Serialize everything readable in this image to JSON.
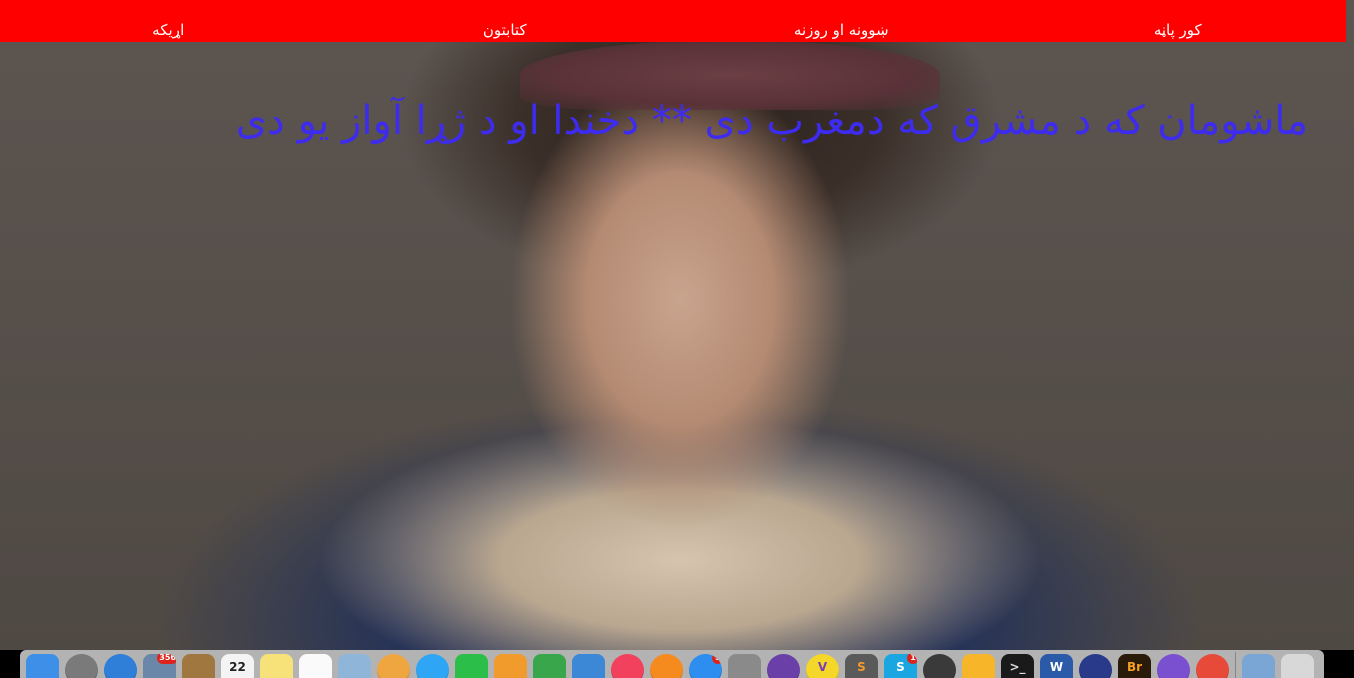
{
  "nav": {
    "items": [
      {
        "label": "کور پاڼه"
      },
      {
        "label": "ښوونه او روزنه"
      },
      {
        "label": "کتابتون"
      },
      {
        "label": "اړیکه"
      }
    ],
    "background_color": "#ff0000",
    "text_color": "#ffffff"
  },
  "headline": {
    "text": "ماشومان که د مشرق که دمغرب دی ** دخندا او د ژړا آواز یو دی",
    "color": "#3d2bf0"
  },
  "dock": {
    "icons": [
      {
        "name": "finder-icon",
        "color": "#3d8fe8"
      },
      {
        "name": "launchpad-icon",
        "color": "#7a7a7a",
        "round": true
      },
      {
        "name": "safari-icon",
        "color": "#2f7fd8",
        "round": true
      },
      {
        "name": "mail-stamp-icon",
        "color": "#6a86a8",
        "badge": "356"
      },
      {
        "name": "contacts-icon",
        "color": "#a0773f"
      },
      {
        "name": "calendar-icon",
        "color": "#f4f4f4",
        "text": "22",
        "text_color": "#222222"
      },
      {
        "name": "notes-icon",
        "color": "#f7e27a"
      },
      {
        "name": "reminders-icon",
        "color": "#fafafa"
      },
      {
        "name": "preview-icon",
        "color": "#8fb6d9"
      },
      {
        "name": "photos-icon",
        "color": "#f0a640",
        "round": true
      },
      {
        "name": "messages-icon",
        "color": "#2fa6f5",
        "round": true
      },
      {
        "name": "facetime-icon",
        "color": "#2bbf4a"
      },
      {
        "name": "pages-icon",
        "color": "#f19b2c"
      },
      {
        "name": "numbers-icon",
        "color": "#3aa64b"
      },
      {
        "name": "keynote-icon",
        "color": "#3c87d6"
      },
      {
        "name": "itunes-icon",
        "color": "#f2415c",
        "round": true
      },
      {
        "name": "ibooks-icon",
        "color": "#f58a1f",
        "round": true
      },
      {
        "name": "app-store-icon",
        "color": "#2d8ef0",
        "round": true,
        "badge": "5"
      },
      {
        "name": "system-preferences-icon",
        "color": "#8a8a8a"
      },
      {
        "name": "github-icon",
        "color": "#6b3fa8",
        "round": true
      },
      {
        "name": "vectorize-icon",
        "color": "#f5d72a",
        "round": true,
        "text": "V",
        "text_color": "#7a3fb0"
      },
      {
        "name": "sublime-icon",
        "color": "#5a5a5a",
        "text": "S",
        "text_color": "#f59a2a"
      },
      {
        "name": "skype-icon",
        "color": "#1aa6e0",
        "text": "S",
        "badge": "1"
      },
      {
        "name": "sequel-pro-icon",
        "color": "#3a3a3a",
        "round": true
      },
      {
        "name": "sketch-icon",
        "color": "#f7b52a"
      },
      {
        "name": "terminal-icon",
        "color": "#1a1a1a",
        "text": ">_",
        "text_color": "#dddddd"
      },
      {
        "name": "word-icon",
        "color": "#2b5aa8",
        "text": "W"
      },
      {
        "name": "inkscape-icon",
        "color": "#2a3a8a",
        "round": true
      },
      {
        "name": "bridge-icon",
        "color": "#2a1a0a",
        "text": "Br",
        "text_color": "#f5a020"
      },
      {
        "name": "viber-icon",
        "color": "#7a4fd0",
        "round": true
      },
      {
        "name": "chrome-icon",
        "color": "#e84a3a",
        "round": true
      },
      {
        "separator": true
      },
      {
        "name": "downloads-stack-icon",
        "color": "#7aa6d6"
      },
      {
        "name": "trash-icon",
        "color": "#d8d8d8"
      }
    ]
  }
}
